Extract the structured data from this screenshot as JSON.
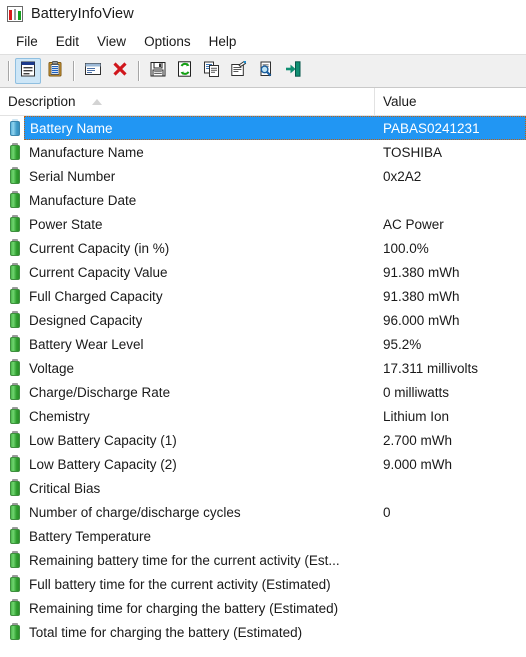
{
  "window": {
    "title": "BatteryInfoView",
    "icon": "battery-info-app-icon"
  },
  "menubar": {
    "items": [
      {
        "label": "File",
        "name": "menu-file"
      },
      {
        "label": "Edit",
        "name": "menu-edit"
      },
      {
        "label": "View",
        "name": "menu-view"
      },
      {
        "label": "Options",
        "name": "menu-options"
      },
      {
        "label": "Help",
        "name": "menu-help"
      }
    ]
  },
  "toolbar": {
    "buttons": [
      {
        "icon": "report-view-icon",
        "name": "toolbar-report-view",
        "active": true
      },
      {
        "icon": "clipboard-icon",
        "name": "toolbar-clipboard",
        "active": false
      },
      {
        "icon": "window-properties-icon",
        "name": "toolbar-window-properties",
        "active": false
      },
      {
        "icon": "delete-x-icon",
        "name": "toolbar-delete",
        "active": false
      },
      {
        "icon": "save-floppy-icon",
        "name": "toolbar-save",
        "active": false
      },
      {
        "icon": "refresh-icon",
        "name": "toolbar-refresh",
        "active": false
      },
      {
        "icon": "copy-icon",
        "name": "toolbar-copy",
        "active": false
      },
      {
        "icon": "properties-icon",
        "name": "toolbar-properties",
        "active": false
      },
      {
        "icon": "find-icon",
        "name": "toolbar-find",
        "active": false
      },
      {
        "icon": "exit-door-icon",
        "name": "toolbar-exit",
        "active": false
      }
    ]
  },
  "list": {
    "columns": [
      {
        "label": "Description",
        "sort": "ascending"
      },
      {
        "label": "Value",
        "sort": "none"
      }
    ],
    "rows": [
      {
        "description": "Battery Name",
        "value": "PABAS0241231",
        "selected": true
      },
      {
        "description": "Manufacture Name",
        "value": "TOSHIBA",
        "selected": false
      },
      {
        "description": "Serial Number",
        "value": "0x2A2",
        "selected": false
      },
      {
        "description": "Manufacture Date",
        "value": "",
        "selected": false
      },
      {
        "description": "Power State",
        "value": "AC Power",
        "selected": false
      },
      {
        "description": "Current Capacity (in %)",
        "value": "100.0%",
        "selected": false
      },
      {
        "description": "Current Capacity Value",
        "value": "91.380 mWh",
        "selected": false
      },
      {
        "description": "Full Charged Capacity",
        "value": "91.380 mWh",
        "selected": false
      },
      {
        "description": "Designed Capacity",
        "value": "96.000 mWh",
        "selected": false
      },
      {
        "description": "Battery Wear Level",
        "value": "95.2%",
        "selected": false
      },
      {
        "description": "Voltage",
        "value": "17.311 millivolts",
        "selected": false
      },
      {
        "description": "Charge/Discharge Rate",
        "value": "0 milliwatts",
        "selected": false
      },
      {
        "description": "Chemistry",
        "value": "Lithium Ion",
        "selected": false
      },
      {
        "description": "Low Battery Capacity (1)",
        "value": "2.700 mWh",
        "selected": false
      },
      {
        "description": "Low Battery Capacity (2)",
        "value": "9.000 mWh",
        "selected": false
      },
      {
        "description": "Critical Bias",
        "value": "",
        "selected": false
      },
      {
        "description": "Number of charge/discharge cycles",
        "value": "0",
        "selected": false
      },
      {
        "description": "Battery Temperature",
        "value": "",
        "selected": false
      },
      {
        "description": "Remaining battery time for the current activity (Est...",
        "value": "",
        "selected": false
      },
      {
        "description": "Full battery time for the current activity (Estimated)",
        "value": "",
        "selected": false
      },
      {
        "description": "Remaining time for charging the battery (Estimated)",
        "value": "",
        "selected": false
      },
      {
        "description": "Total  time for charging the battery (Estimated)",
        "value": "",
        "selected": false
      }
    ]
  },
  "colors": {
    "selection": "#2196f3",
    "toolbar_bg": "#f0f0f0",
    "battery_green": "#4cb94c",
    "focus_outline": "#c06010"
  }
}
